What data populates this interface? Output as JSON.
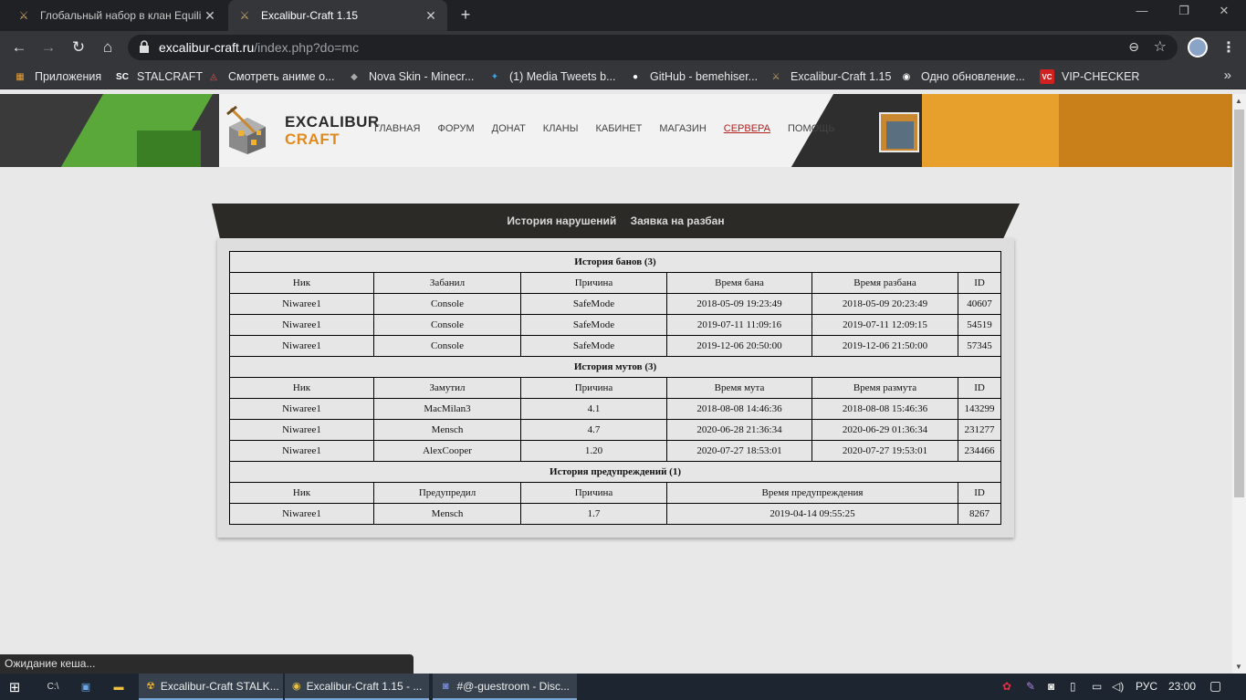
{
  "browser": {
    "tabs": [
      {
        "title": "Глобальный набор в клан Equili",
        "active": false
      },
      {
        "title": "Excalibur-Craft 1.15",
        "active": true
      }
    ],
    "url_host": "excalibur-craft.ru",
    "url_path": "/index.php?do=mc",
    "bookmarks": [
      {
        "label": "Приложения",
        "icon": "apps-grid-icon"
      },
      {
        "label": "STALCRAFT",
        "icon": "sc-icon"
      },
      {
        "label": "Смотреть аниме о...",
        "icon": "anime-icon"
      },
      {
        "label": "Nova Skin - Minecr...",
        "icon": "nova-skin-icon"
      },
      {
        "label": "(1) Media Tweets b...",
        "icon": "twitter-icon"
      },
      {
        "label": "GitHub - bemehiser...",
        "icon": "github-icon"
      },
      {
        "label": "Excalibur-Craft 1.15",
        "icon": "sword-icon"
      },
      {
        "label": "Одно обновление...",
        "icon": "update-icon"
      },
      {
        "label": "VIP-CHECKER",
        "icon": "vc-icon"
      }
    ],
    "status_text": "Ожидание кеша..."
  },
  "site": {
    "logo_line1": "EXCALIBUR",
    "logo_line2": "CRAFT",
    "nav": [
      "ГЛАВНАЯ",
      "ФОРУМ",
      "ДОНАТ",
      "КЛАНЫ",
      "КАБИНЕТ",
      "МАГАЗИН",
      "СЕРВЕРА",
      "ПОМОЩЬ"
    ],
    "nav_current": "СЕРВЕРА"
  },
  "panel": {
    "link1": "История нарушений",
    "link2": "Заявка на разбан"
  },
  "bans": {
    "title": "История банов (3)",
    "headers": [
      "Ник",
      "Забанил",
      "Причина",
      "Время бана",
      "Время разбана",
      "ID"
    ],
    "rows": [
      [
        "Niwaree1",
        "Console",
        "SafeMode",
        "2018-05-09 19:23:49",
        "2018-05-09 20:23:49",
        "40607"
      ],
      [
        "Niwaree1",
        "Console",
        "SafeMode",
        "2019-07-11 11:09:16",
        "2019-07-11 12:09:15",
        "54519"
      ],
      [
        "Niwaree1",
        "Console",
        "SafeMode",
        "2019-12-06 20:50:00",
        "2019-12-06 21:50:00",
        "57345"
      ]
    ]
  },
  "mutes": {
    "title": "История мутов (3)",
    "headers": [
      "Ник",
      "Замутил",
      "Причина",
      "Время мута",
      "Время размута",
      "ID"
    ],
    "rows": [
      [
        "Niwaree1",
        "MacMilan3",
        "4.1",
        "2018-08-08 14:46:36",
        "2018-08-08 15:46:36",
        "143299"
      ],
      [
        "Niwaree1",
        "Mensch",
        "4.7",
        "2020-06-28 21:36:34",
        "2020-06-29 01:36:34",
        "231277"
      ],
      [
        "Niwaree1",
        "AlexCooper",
        "1.20",
        "2020-07-27 18:53:01",
        "2020-07-27 19:53:01",
        "234466"
      ]
    ]
  },
  "warns": {
    "title": "История предупреждений (1)",
    "headers": [
      "Ник",
      "Предупредил",
      "Причина",
      "Время предупреждения",
      "ID"
    ],
    "rows": [
      [
        "Niwaree1",
        "Mensch",
        "1.7",
        "2019-04-14 09:55:25",
        "8267"
      ]
    ]
  },
  "taskbar": {
    "items": [
      {
        "label": "Excalibur-Craft STALK...",
        "icon": "excalibur-app-icon"
      },
      {
        "label": "Excalibur-Craft 1.15 - ...",
        "icon": "chrome-icon"
      },
      {
        "label": "#@-guestroom - Disc...",
        "icon": "discord-icon"
      }
    ],
    "lang": "РУС",
    "time": "23:00"
  }
}
